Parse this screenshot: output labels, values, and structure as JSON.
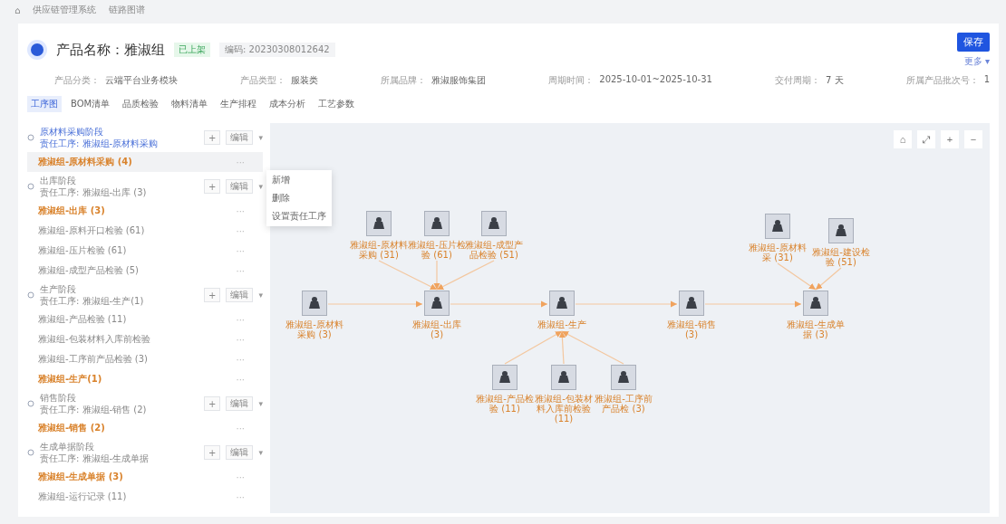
{
  "breadcrumb": [
    "⌂",
    "供应链管理系统",
    "链路图谱"
  ],
  "header": {
    "title": "产品名称：雅淑组",
    "status": "已上架",
    "code": "编码: 20230308012642",
    "primary_button": "保存",
    "more_link": "更多 ▾"
  },
  "info": [
    {
      "label": "产品分类：",
      "value": "云端平台业务模块"
    },
    {
      "label": "产品类型：",
      "value": "服装类"
    },
    {
      "label": "所属品牌：",
      "value": "雅淑服饰集团"
    },
    {
      "label": "周期时间：",
      "value": "2025-10-01~2025-10-31"
    },
    {
      "label": "交付周期：",
      "value": "7 天"
    },
    {
      "label": "所属产品批次号：",
      "value": "1"
    }
  ],
  "tabs": [
    {
      "label": "工序图",
      "selected": true
    },
    {
      "label": "BOM清单",
      "selected": false
    },
    {
      "label": "品质检验",
      "selected": false
    },
    {
      "label": "物料清单",
      "selected": false
    },
    {
      "label": "生产排程",
      "selected": false
    },
    {
      "label": "成本分析",
      "selected": false
    },
    {
      "label": "工艺参数",
      "selected": false
    }
  ],
  "steps": [
    {
      "kind": "group",
      "title": "原材料采购阶段",
      "subtitle": "责任工序: 雅淑组-原材料采购",
      "active": true,
      "add": "+",
      "edit": "编辑",
      "caret": "▾"
    },
    {
      "kind": "step",
      "label": "雅淑组-原材料采购 (4)",
      "key": true,
      "selected": true,
      "more": "···"
    },
    {
      "kind": "group",
      "title": "出库阶段",
      "subtitle": "责任工序: 雅淑组-出库 (3)",
      "active": false,
      "add": "+",
      "edit": "编辑",
      "caret": "▾"
    },
    {
      "kind": "step",
      "label": "雅淑组-出库 (3)",
      "key": true,
      "selected": false,
      "more": "···"
    },
    {
      "kind": "step",
      "label": "雅淑组-原料开口检验 (61)",
      "key": false,
      "selected": false,
      "more": "···"
    },
    {
      "kind": "step",
      "label": "雅淑组-压片检验 (61)",
      "key": false,
      "selected": false,
      "more": "···"
    },
    {
      "kind": "step",
      "label": "雅淑组-成型产品检验 (5)",
      "key": false,
      "selected": false,
      "more": "···"
    },
    {
      "kind": "group",
      "title": "生产阶段",
      "subtitle": "责任工序: 雅淑组-生产(1)",
      "active": false,
      "add": "+",
      "edit": "编辑",
      "caret": "▾"
    },
    {
      "kind": "step",
      "label": "雅淑组-产品检验 (11)",
      "key": false,
      "selected": false,
      "more": "···"
    },
    {
      "kind": "step",
      "label": "雅淑组-包装材料入库前检验",
      "key": false,
      "selected": false,
      "more": "···"
    },
    {
      "kind": "step",
      "label": "雅淑组-工序前产品检验 (3)",
      "key": false,
      "selected": false,
      "more": "···"
    },
    {
      "kind": "step",
      "label": "雅淑组-生产(1)",
      "key": true,
      "selected": false,
      "more": "···"
    },
    {
      "kind": "group",
      "title": "销售阶段",
      "subtitle": "责任工序: 雅淑组-销售 (2)",
      "active": false,
      "add": "+",
      "edit": "编辑",
      "caret": "▾"
    },
    {
      "kind": "step",
      "label": "雅淑组-销售 (2)",
      "key": true,
      "selected": false,
      "more": "···"
    },
    {
      "kind": "group",
      "title": "生成单据阶段",
      "subtitle": "责任工序: 雅淑组-生成单据",
      "active": false,
      "add": "+",
      "edit": "编辑",
      "caret": "▾"
    },
    {
      "kind": "step",
      "label": "雅淑组-生成单据 (3)",
      "key": true,
      "selected": false,
      "more": "···"
    },
    {
      "kind": "step",
      "label": "雅淑组-运行记录 (11)",
      "key": false,
      "selected": false,
      "more": "···"
    }
  ],
  "context_menu": {
    "items": [
      "新增",
      "删除",
      "设置责任工序"
    ]
  },
  "graph": {
    "toolbar": [
      "⌂",
      "⤢",
      "+",
      "−"
    ],
    "nodes": [
      {
        "label": "雅淑组-原材料采购 (3)"
      },
      {
        "label": "雅淑组-出库 (3)"
      },
      {
        "label": "雅淑组-生产"
      },
      {
        "label": "雅淑组-销售 (3)"
      },
      {
        "label": "雅淑组-生成单据 (3)"
      },
      {
        "label": "雅淑组-原材料采购 (31)"
      },
      {
        "label": "雅淑组-压片检验 (61)"
      },
      {
        "label": "雅淑组-成型产品检验 (51)"
      },
      {
        "label": "雅淑组-产品检验 (11)"
      },
      {
        "label": "雅淑组-包装材料入库前检验 (11)"
      },
      {
        "label": "雅淑组-工序前产品检 (3)"
      },
      {
        "label": "雅淑组-原材料采 (31)"
      },
      {
        "label": "雅淑组-建设检验 (51)"
      }
    ]
  }
}
